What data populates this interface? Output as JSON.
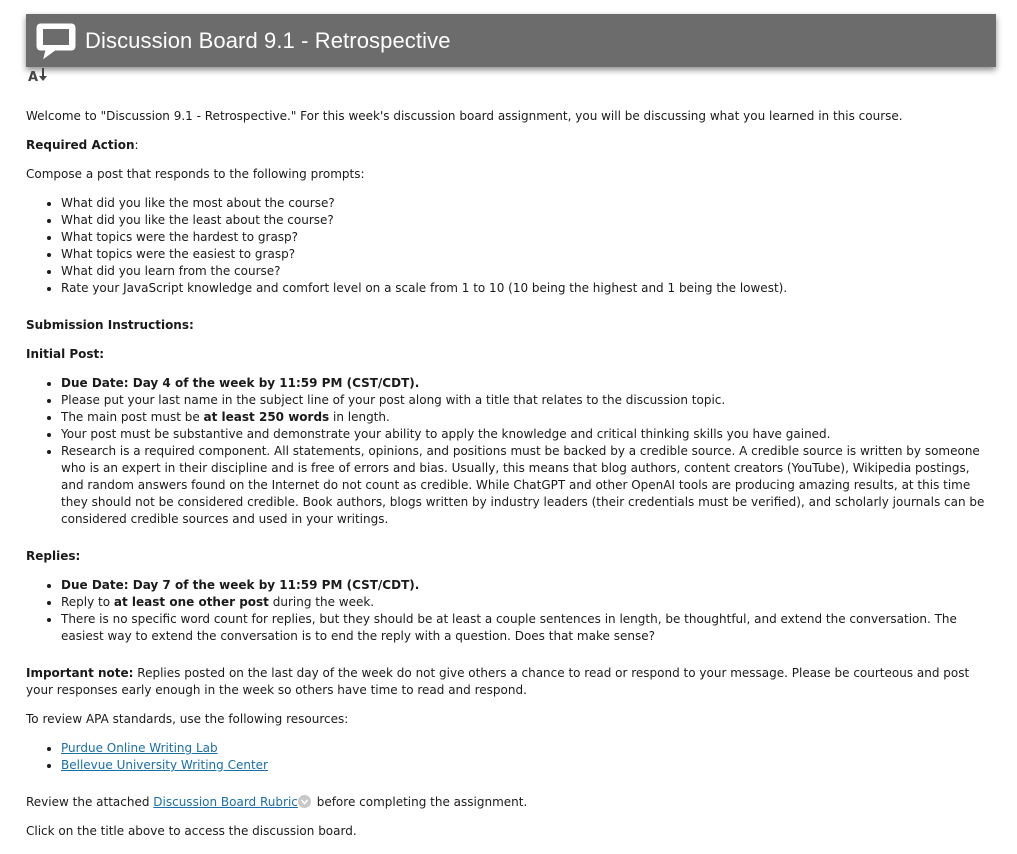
{
  "header": {
    "title": "Discussion Board 9.1 - Retrospective"
  },
  "intro": "Welcome to \"Discussion 9.1 - Retrospective.\"  For this week's discussion board assignment, you will be discussing what you learned in this course.",
  "required": {
    "heading": "Required Action",
    "colon": ":",
    "instruction": "Compose a post that responds to the following prompts:",
    "prompts": [
      "What did you like the most about the course?",
      "What did you like the least about the course?",
      "What topics were the hardest to grasp?",
      "What topics were the easiest to grasp?",
      "What did you learn from the course?",
      "Rate your JavaScript knowledge and comfort level on a scale from 1 to 10 (10 being the highest and 1 being the lowest)."
    ]
  },
  "submission": {
    "heading": "Submission Instructions:"
  },
  "initial": {
    "heading": "Initial Post:",
    "due": "Due Date: Day 4 of the week by 11:59 PM (CST/CDT).",
    "item2": "Please put your last name in the subject line of your post along with a title that relates to the discussion topic.",
    "item3_pre": "The main post must be ",
    "item3_bold": "at least 250 words",
    "item3_post": " in length.",
    "item4": "Your post must be substantive and demonstrate your ability to apply the knowledge and critical thinking skills you have gained.",
    "item5": "Research is a required component.  All statements, opinions, and positions must be backed by a credible source.  A credible source is written by someone who is an expert in their discipline and is free of errors and bias.  Usually, this means that blog authors, content creators (YouTube), Wikipedia postings, and random answers found on the Internet do not count as credible.  While ChatGPT and other OpenAI tools are producing amazing results, at this time they should not be considered credible.  Book authors, blogs written by industry leaders (their credentials must be verified), and scholarly journals can be considered credible sources and used in your writings."
  },
  "replies": {
    "heading": "Replies:",
    "due": "Due Date: Day 7 of the week by 11:59 PM (CST/CDT).",
    "item2_pre": "Reply to ",
    "item2_bold": "at least one other post",
    "item2_post": " during the week.",
    "item3": "There is no specific word count for replies, but they should be at least a couple sentences in length, be thoughtful, and extend the conversation.  The easiest way to extend the conversation is to end the reply with a question.  Does that make sense?"
  },
  "note": {
    "label": "Important note:",
    "text": "  Replies posted on the last day of the week do not give others a chance to read or respond to your message.  Please be courteous and post your responses early enough in the week so others have time to read and respond."
  },
  "apa": {
    "text": "To review APA standards, use the following resources:",
    "links": [
      "Purdue Online Writing Lab",
      "Bellevue University Writing Center"
    ]
  },
  "rubric": {
    "pre": "Review the attached ",
    "link": "Discussion Board Rubric",
    "post": " before completing the assignment."
  },
  "footer": "Click on the title above to access the discussion board."
}
